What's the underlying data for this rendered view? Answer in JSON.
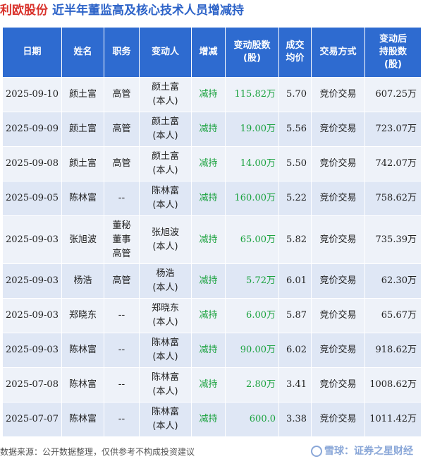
{
  "header": {
    "stock_name": "利欧股份",
    "title": "近半年董监高及核心技术人员增减持"
  },
  "table": {
    "columns": [
      "日期",
      "姓名",
      "职务",
      "变动人",
      "增减",
      "变动股数\n(股)",
      "成交\n均价",
      "交易方式",
      "变动后\n持股数\n(股)"
    ],
    "rows": [
      {
        "date": "2025-09-10",
        "name": "颜土富",
        "position": "高管",
        "person": "颜土富\n(本人)",
        "direction": "减持",
        "shares": "115.82万",
        "price": "5.70",
        "method": "竞价交易",
        "after": "607.25万"
      },
      {
        "date": "2025-09-09",
        "name": "颜土富",
        "position": "高管",
        "person": "颜土富\n(本人)",
        "direction": "减持",
        "shares": "19.00万",
        "price": "5.56",
        "method": "竞价交易",
        "after": "723.07万"
      },
      {
        "date": "2025-09-08",
        "name": "颜土富",
        "position": "高管",
        "person": "颜土富\n(本人)",
        "direction": "减持",
        "shares": "14.00万",
        "price": "5.50",
        "method": "竞价交易",
        "after": "742.07万"
      },
      {
        "date": "2025-09-05",
        "name": "陈林富",
        "position": "--",
        "person": "陈林富\n(本人)",
        "direction": "减持",
        "shares": "160.00万",
        "price": "5.22",
        "method": "竞价交易",
        "after": "758.62万"
      },
      {
        "date": "2025-09-03",
        "name": "张旭波",
        "position": "董秘\n董事\n高管",
        "person": "张旭波\n(本人)",
        "direction": "减持",
        "shares": "65.00万",
        "price": "5.82",
        "method": "竞价交易",
        "after": "735.39万"
      },
      {
        "date": "2025-09-03",
        "name": "杨浩",
        "position": "高管",
        "person": "杨浩\n(本人)",
        "direction": "减持",
        "shares": "5.72万",
        "price": "6.01",
        "method": "竞价交易",
        "after": "62.30万"
      },
      {
        "date": "2025-09-03",
        "name": "郑晓东",
        "position": "--",
        "person": "郑晓东\n(本人)",
        "direction": "减持",
        "shares": "6.00万",
        "price": "5.87",
        "method": "竞价交易",
        "after": "65.67万"
      },
      {
        "date": "2025-09-03",
        "name": "陈林富",
        "position": "--",
        "person": "陈林富\n(本人)",
        "direction": "减持",
        "shares": "90.00万",
        "price": "6.02",
        "method": "竞价交易",
        "after": "918.62万"
      },
      {
        "date": "2025-07-08",
        "name": "陈林富",
        "position": "--",
        "person": "陈林富\n(本人)",
        "direction": "减持",
        "shares": "2.80万",
        "price": "3.41",
        "method": "竞价交易",
        "after": "1008.62万"
      },
      {
        "date": "2025-07-07",
        "name": "陈林富",
        "position": "--",
        "person": "陈林富\n(本人)",
        "direction": "减持",
        "shares": "600.0",
        "price": "3.38",
        "method": "竞价交易",
        "after": "1011.42万"
      }
    ]
  },
  "footer": {
    "source": "数据来源：公开数据整理，仅供参考不构成投资建议",
    "brand": "雪球：证券之星财经"
  },
  "watermark": "证券之星",
  "colors": {
    "header_bg": "#2e6bd0",
    "stock_name": "#d9332c",
    "title": "#2d63c8",
    "decrease": "#1aa23e"
  }
}
